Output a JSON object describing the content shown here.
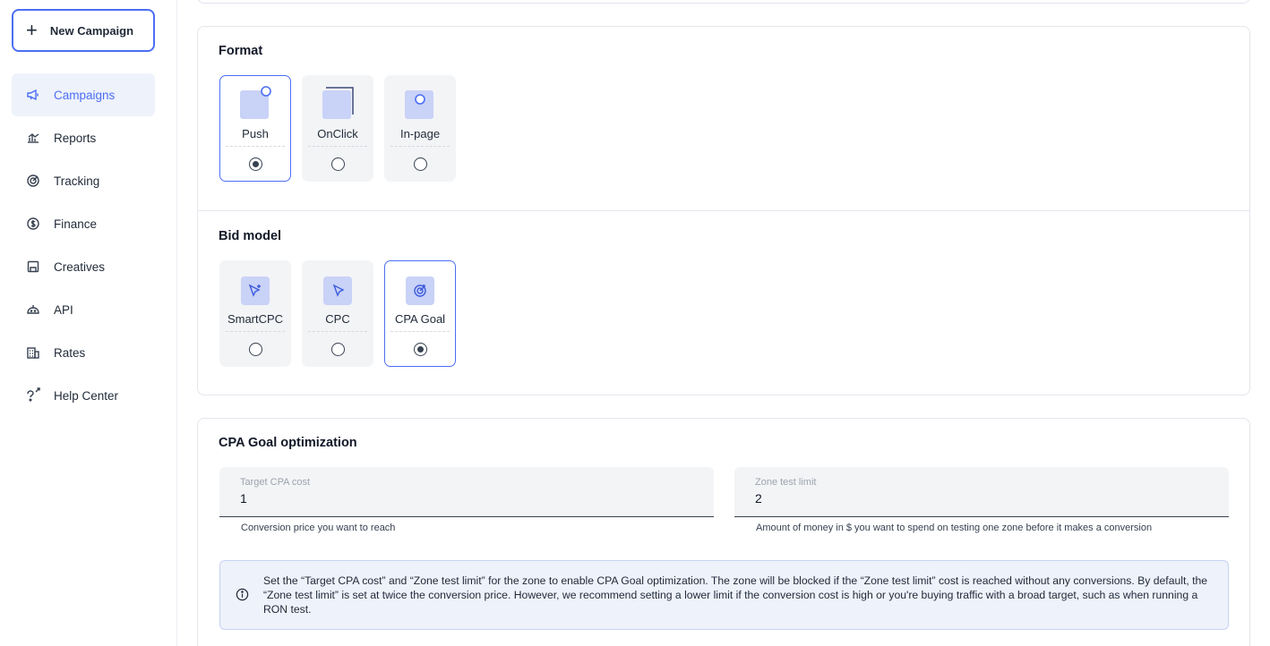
{
  "sidebar": {
    "new_campaign_label": "New Campaign",
    "items": [
      {
        "label": "Campaigns",
        "icon": "megaphone-icon",
        "active": true
      },
      {
        "label": "Reports",
        "icon": "chart-icon",
        "active": false
      },
      {
        "label": "Tracking",
        "icon": "target-icon",
        "active": false
      },
      {
        "label": "Finance",
        "icon": "dollar-icon",
        "active": false
      },
      {
        "label": "Creatives",
        "icon": "image-icon",
        "active": false
      },
      {
        "label": "API",
        "icon": "robot-icon",
        "active": false
      },
      {
        "label": "Rates",
        "icon": "building-icon",
        "active": false
      },
      {
        "label": "Help Center",
        "icon": "question-external-icon",
        "active": false
      }
    ]
  },
  "format": {
    "title": "Format",
    "options": [
      {
        "label": "Push",
        "selected": true
      },
      {
        "label": "OnClick",
        "selected": false
      },
      {
        "label": "In-page",
        "selected": false
      }
    ]
  },
  "bid_model": {
    "title": "Bid model",
    "options": [
      {
        "label": "SmartCPC",
        "selected": false
      },
      {
        "label": "CPC",
        "selected": false
      },
      {
        "label": "CPA Goal",
        "selected": true
      }
    ]
  },
  "cpa": {
    "title": "CPA Goal optimization",
    "target_label": "Target CPA cost",
    "target_value": "1",
    "target_helper": "Conversion price you want to reach",
    "zone_label": "Zone test limit",
    "zone_value": "2",
    "zone_helper": "Amount of money in $ you want to spend on testing one zone before it makes a conversion",
    "info_text": "Set the “Target CPA cost” and “Zone test limit” for the zone to enable CPA Goal optimization. The zone will be blocked if the “Zone test limit” cost is reached without any conversions. By default, the “Zone test limit” is set at twice the conversion price. However, we recommend setting a lower limit if the conversion cost is high or you're buying traffic with a broad target, such as when running a RON test."
  },
  "colors": {
    "accent": "#4c6ef5",
    "active_bg": "#eef2fb",
    "icon_fill": "#c9d2f7"
  }
}
